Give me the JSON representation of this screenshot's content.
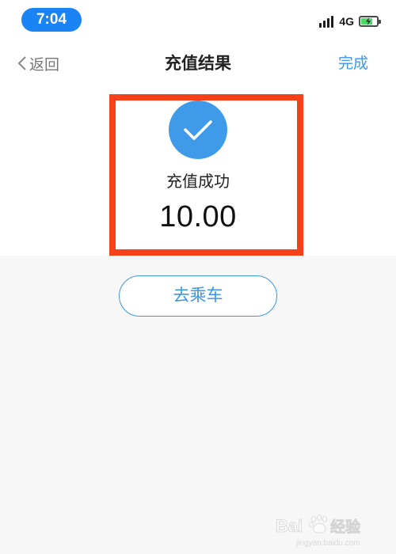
{
  "status_bar": {
    "time": "7:04",
    "network": "4G",
    "battery_level": 0.75,
    "time_pill_color": "#1a84f5"
  },
  "nav": {
    "back_label": "返回",
    "title": "充值结果",
    "done_label": "完成"
  },
  "result": {
    "status_text": "充值成功",
    "amount": "10.00",
    "check_color": "#3f9be9",
    "highlight_color": "#f6411b"
  },
  "actions": {
    "ride_label": "去乘车"
  },
  "watermark": {
    "text": "Baidu 经验",
    "url": "jingyan.baidu.com"
  },
  "colors": {
    "accent": "#3b97e8",
    "page_background": "#f7f7f7"
  }
}
